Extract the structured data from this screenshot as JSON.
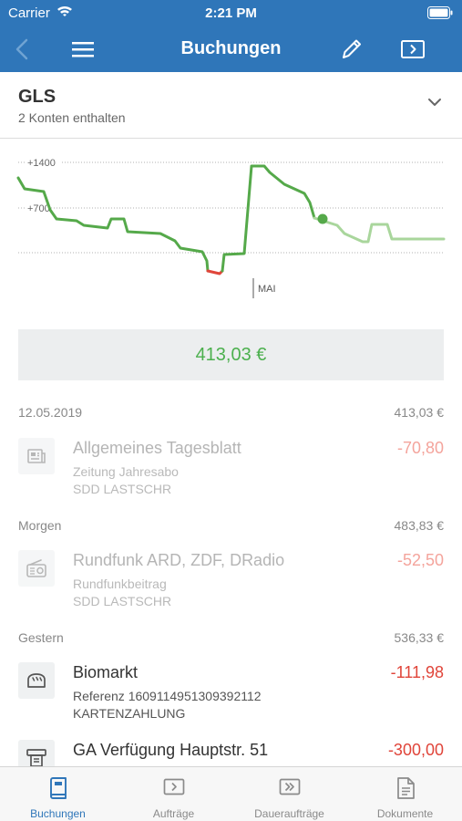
{
  "status_bar": {
    "carrier": "Carrier",
    "time": "2:21 PM"
  },
  "nav": {
    "title": "Buchungen"
  },
  "account": {
    "name": "GLS",
    "subtitle": "2 Konten enthalten"
  },
  "chart_data": {
    "type": "line",
    "y_ticks": [
      "+1400",
      "+700"
    ],
    "marker_label": "MAI",
    "colors": {
      "past": "#55a94a",
      "negative": "#e0453a",
      "future": "#a9d69c"
    }
  },
  "balance": {
    "value": "413,03 €"
  },
  "groups": [
    {
      "date": "12.05.2019",
      "sum": "413,03 €",
      "items": [
        {
          "title": "Allgemeines Tagesblatt",
          "sub1": "Zeitung Jahresabo",
          "sub2": "SDD LASTSCHR",
          "amount": "-70,80",
          "icon": "newspaper-icon"
        }
      ]
    },
    {
      "date": "Morgen",
      "sum": "483,83 €",
      "items": [
        {
          "title": "Rundfunk ARD, ZDF, DRadio",
          "sub1": "Rundfunkbeitrag",
          "sub2": "SDD LASTSCHR",
          "amount": "-52,50",
          "icon": "radio-icon"
        }
      ]
    },
    {
      "date": "Gestern",
      "sum": "536,33 €",
      "items": [
        {
          "title": "Biomarkt",
          "sub1": "Referenz 1609114951309392112",
          "sub2": "KARTENZAHLUNG",
          "amount": "-111,98",
          "icon": "bread-icon"
        },
        {
          "title": "GA Verfügung Hauptstr. 51",
          "sub1": "",
          "sub2": "",
          "amount": "-300,00",
          "icon": "atm-icon"
        }
      ]
    }
  ],
  "tabs": [
    {
      "label": "Buchungen",
      "icon": "book-icon",
      "active": true
    },
    {
      "label": "Aufträge",
      "icon": "transfer-icon",
      "active": false
    },
    {
      "label": "Daueraufträge",
      "icon": "standing-order-icon",
      "active": false
    },
    {
      "label": "Dokumente",
      "icon": "document-icon",
      "active": false
    }
  ]
}
